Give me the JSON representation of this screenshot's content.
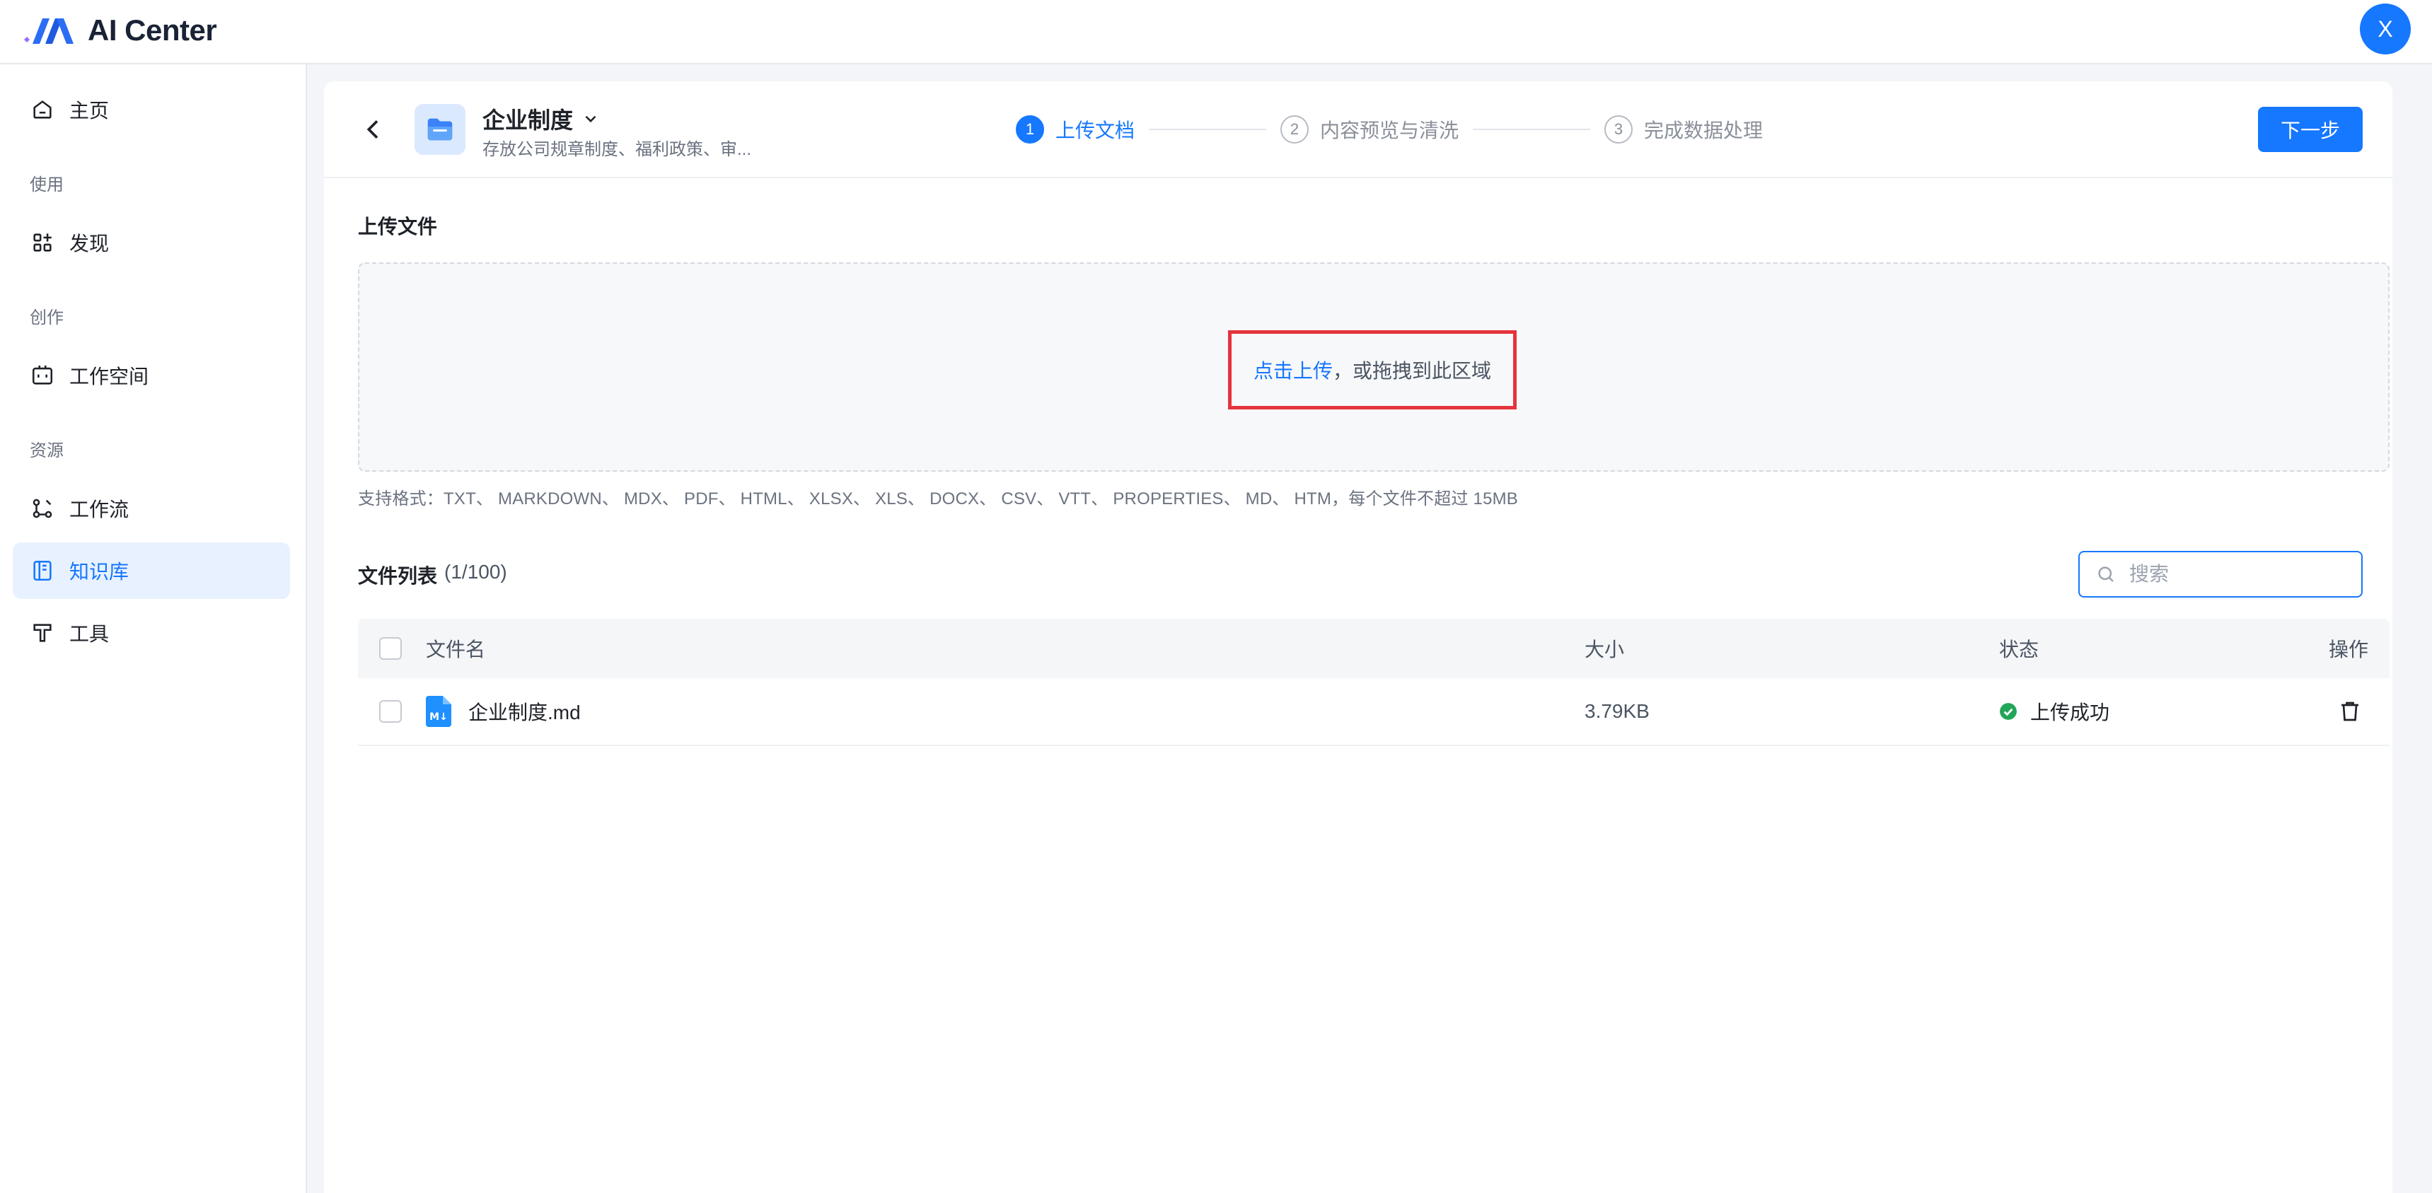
{
  "app": {
    "name": "AI Center",
    "user_initial": "X",
    "accent": "#1677ff"
  },
  "sidebar": {
    "items": [
      {
        "label": "主页",
        "icon": "home-icon"
      },
      {
        "label": "发现",
        "icon": "grid-icon"
      },
      {
        "label": "工作空间",
        "icon": "workspace-icon"
      },
      {
        "label": "工作流",
        "icon": "workflow-icon"
      },
      {
        "label": "知识库",
        "icon": "book-icon",
        "active": true
      },
      {
        "label": "工具",
        "icon": "tool-icon"
      }
    ],
    "sections": {
      "use": "使用",
      "create": "创作",
      "resources": "资源"
    }
  },
  "header": {
    "kb_title": "企业制度",
    "kb_desc": "存放公司规章制度、福利政策、审...",
    "steps": [
      {
        "num": "1",
        "label": "上传文档",
        "active": true
      },
      {
        "num": "2",
        "label": "内容预览与清洗"
      },
      {
        "num": "3",
        "label": "完成数据处理"
      }
    ],
    "next_label": "下一步"
  },
  "upload": {
    "title": "上传文件",
    "click_text": "点击上传",
    "drag_text": "，或拖拽到此区域",
    "formats": "支持格式：TXT、 MARKDOWN、 MDX、 PDF、 HTML、 XLSX、 XLS、 DOCX、 CSV、 VTT、 PROPERTIES、 MD、 HTM，每个文件不超过 15MB"
  },
  "file_list": {
    "title": "文件列表",
    "count": "(1/100)",
    "search_placeholder": "搜索",
    "columns": {
      "name": "文件名",
      "size": "大小",
      "status": "状态",
      "action": "操作"
    },
    "rows": [
      {
        "name": "企业制度.md",
        "size": "3.79KB",
        "status": "上传成功",
        "status_color": "#22a559"
      }
    ]
  }
}
